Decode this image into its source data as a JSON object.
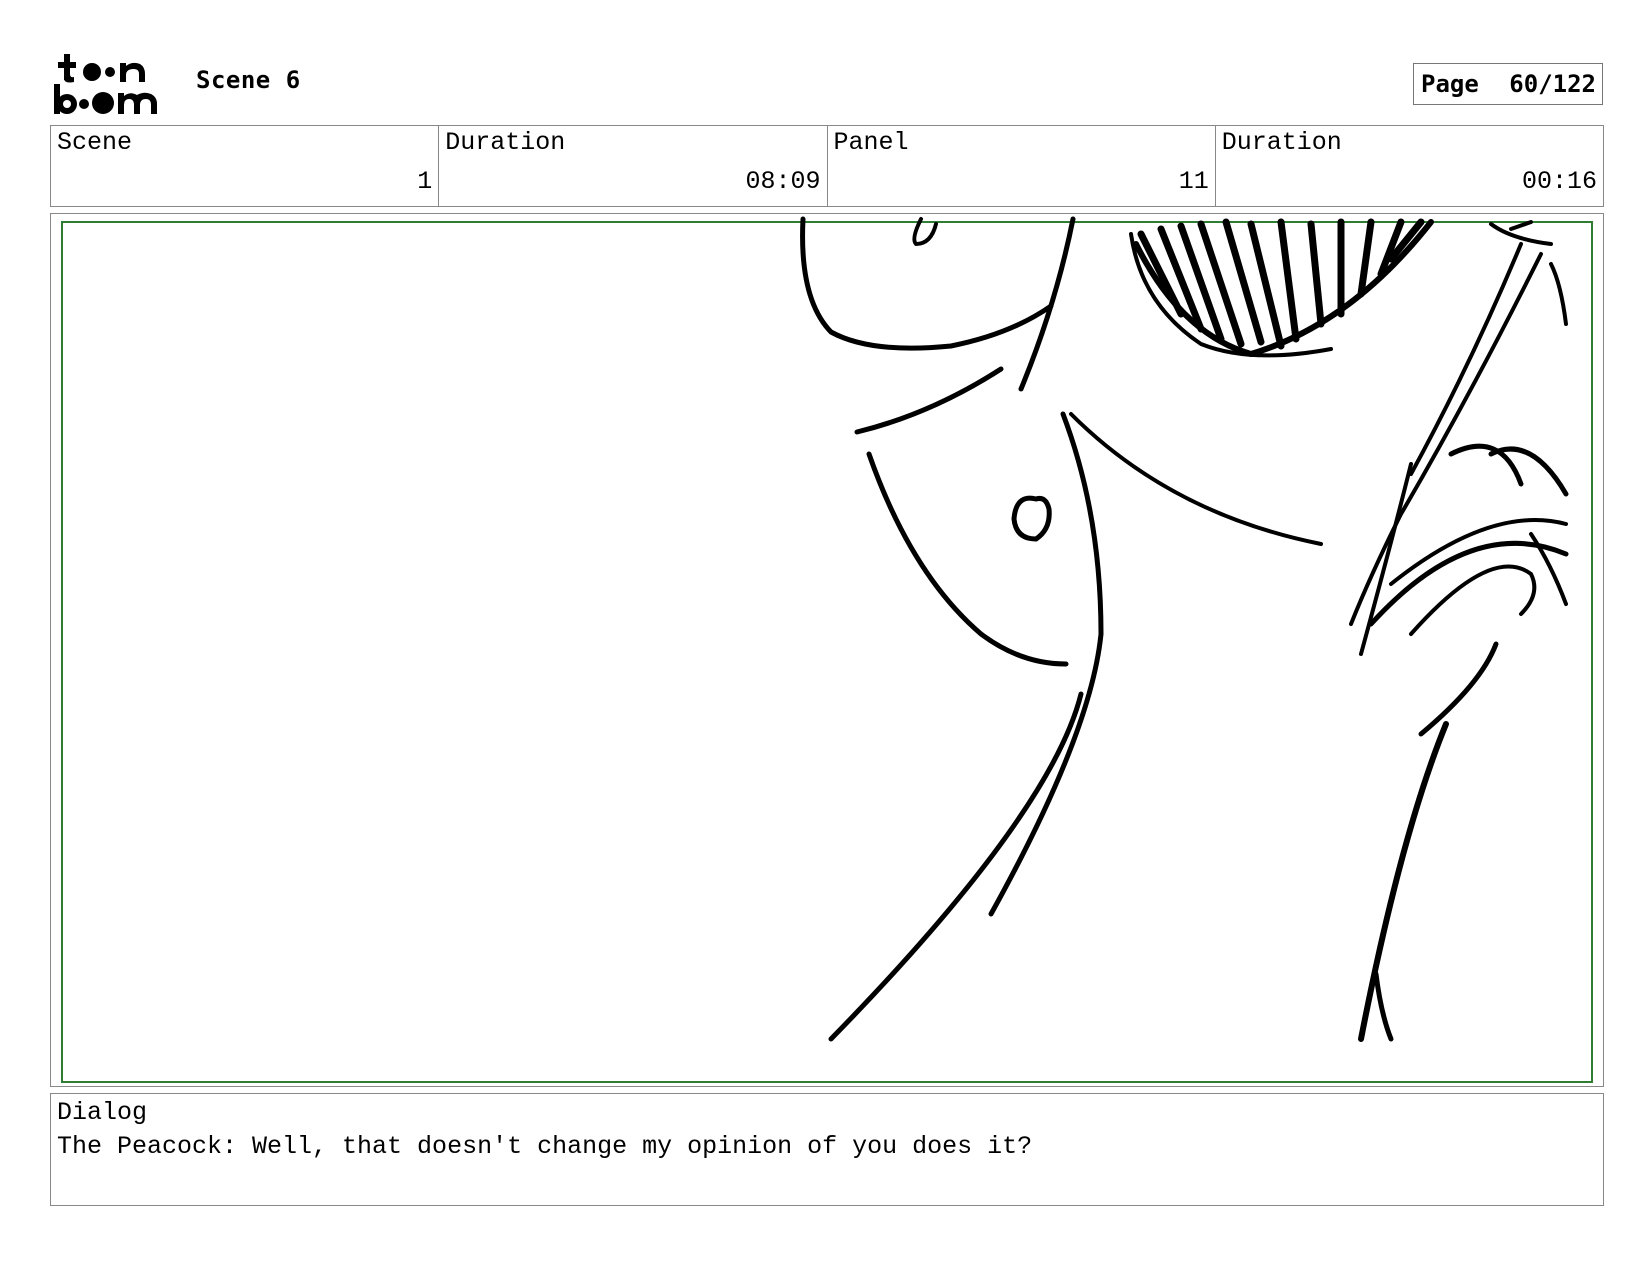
{
  "header": {
    "logo": {
      "text": "toon boom",
      "icon": "toon-boom-logo"
    },
    "scene_title": "Scene 6",
    "page_label": "Page",
    "page_value": "60/122"
  },
  "info": {
    "scene": {
      "label": "Scene",
      "value": "1"
    },
    "scene_duration": {
      "label": "Duration",
      "value": "08:09"
    },
    "panel": {
      "label": "Panel",
      "value": "11"
    },
    "panel_duration": {
      "label": "Duration",
      "value": "00:16"
    }
  },
  "panel_image": {
    "description_icon": "storyboard-sketch",
    "safe_area_color": "#2e7d32"
  },
  "dialog": {
    "label": "Dialog",
    "text": "The Peacock: Well, that doesn't change my opinion of you does it?"
  }
}
